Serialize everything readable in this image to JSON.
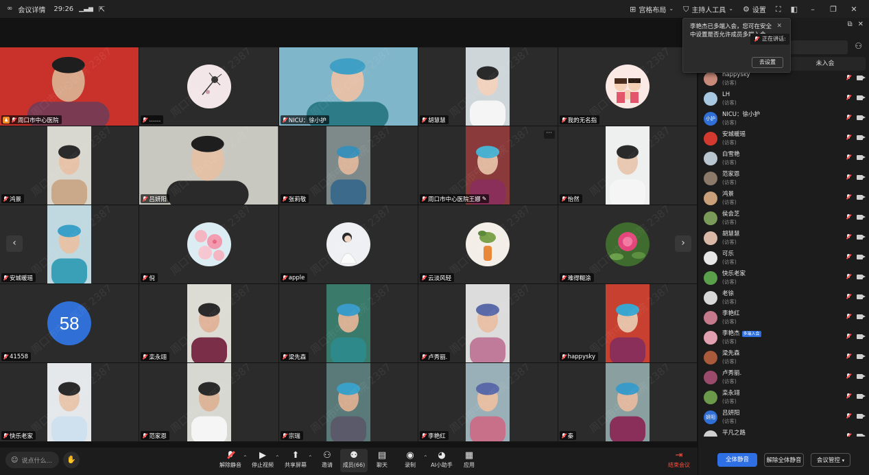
{
  "topbar": {
    "title": "会议详情",
    "duration": "29:26",
    "layout_label": "宫格布局",
    "host_tools_label": "主持人工具",
    "settings_label": "设置"
  },
  "watermark": "周口市中心医院 2387",
  "tiles": [
    {
      "name": "周口市中心医院",
      "kind": "video",
      "host": true
    },
    {
      "name": "……",
      "kind": "avatar",
      "avatar": "dandelion-flower"
    },
    {
      "name": "NICU：徐小护",
      "kind": "video"
    },
    {
      "name": "胡慧慧",
      "kind": "portrait"
    },
    {
      "name": "我的无名指",
      "kind": "avatar",
      "avatar": "cartoon-family"
    },
    {
      "name": "鸿景",
      "kind": "portrait"
    },
    {
      "name": "吕妍阳",
      "kind": "video"
    },
    {
      "name": "张莉敬",
      "kind": "portrait"
    },
    {
      "name": "周口市中心医院王娜",
      "kind": "portrait",
      "more": true,
      "pen": true
    },
    {
      "name": "怡然",
      "kind": "portrait"
    },
    {
      "name": "安城暖瑶",
      "kind": "portrait"
    },
    {
      "name": "倪",
      "kind": "avatar",
      "avatar": "pink-blossom"
    },
    {
      "name": "apple",
      "kind": "avatar",
      "avatar": "girl-white-dress"
    },
    {
      "name": "云淡风轻",
      "kind": "avatar",
      "avatar": "plant-vase"
    },
    {
      "name": "难得糊涂",
      "kind": "avatar",
      "avatar": "pink-flower"
    },
    {
      "name": "41558",
      "kind": "number",
      "number": "58"
    },
    {
      "name": "栾永翊",
      "kind": "portrait"
    },
    {
      "name": "梁先森",
      "kind": "portrait"
    },
    {
      "name": "卢秀丽.",
      "kind": "portrait"
    },
    {
      "name": "happysky",
      "kind": "portrait"
    },
    {
      "name": "快乐老家",
      "kind": "portrait"
    },
    {
      "name": "范家恩",
      "kind": "portrait"
    },
    {
      "name": "宗瑞",
      "kind": "portrait"
    },
    {
      "name": "李艳红",
      "kind": "portrait"
    },
    {
      "name": "秦",
      "kind": "portrait"
    }
  ],
  "toolbar": {
    "chat_placeholder": "说点什么...",
    "tools": [
      {
        "label": "解除静音",
        "icon": "mic-off-icon"
      },
      {
        "label": "停止视频",
        "icon": "camera-icon"
      },
      {
        "label": "共享屏幕",
        "icon": "share-screen-icon"
      },
      {
        "label": "邀请",
        "icon": "invite-icon"
      },
      {
        "label": "成员(66)",
        "icon": "members-icon"
      },
      {
        "label": "聊天",
        "icon": "chat-icon"
      },
      {
        "label": "录制",
        "icon": "record-icon"
      },
      {
        "label": "AI小助手",
        "icon": "ai-assistant-icon"
      },
      {
        "label": "应用",
        "icon": "apps-icon"
      }
    ],
    "end_label": "结束会议"
  },
  "notice": {
    "text": "李艳杰已多端入会，您可在安全中设置是否允许成员多端入会",
    "speaking": "正在讲话:",
    "button": "去设置"
  },
  "panel": {
    "tab_not_joined": "未入会",
    "role": "(访客)",
    "members": [
      {
        "name": "happysky",
        "avatar_color": "#c98a7a"
      },
      {
        "name": "LH",
        "avatar_color": "#a8c7e0"
      },
      {
        "name": "NICU：徐小护",
        "avatar_text": "小护",
        "avatar_color": "#2f6fd6"
      },
      {
        "name": "安城暖瑶",
        "avatar_color": "#d23a2f"
      },
      {
        "name": "白雪艳",
        "avatar_color": "#b9c6d0"
      },
      {
        "name": "范家恩",
        "avatar_color": "#8b7a6a"
      },
      {
        "name": "鸿景",
        "avatar_color": "#c9a07a"
      },
      {
        "name": "侯会芝",
        "avatar_color": "#7a9a5a"
      },
      {
        "name": "胡慧慧",
        "avatar_color": "#d9b8a8"
      },
      {
        "name": "可乐",
        "avatar_color": "#e6e6e6"
      },
      {
        "name": "快乐老家",
        "avatar_color": "#5aa04a"
      },
      {
        "name": "老徐",
        "avatar_color": "#d8d8d8"
      },
      {
        "name": "李艳红",
        "avatar_color": "#c47a8a"
      },
      {
        "name": "李艳杰",
        "avatar_color": "#e0a0b0",
        "badge": "多端入会"
      },
      {
        "name": "梁先森",
        "avatar_color": "#a85a3a"
      },
      {
        "name": "卢秀丽.",
        "avatar_color": "#9a4a6a"
      },
      {
        "name": "栾永翊",
        "avatar_color": "#6a9a4a"
      },
      {
        "name": "吕妍阳",
        "avatar_text": "妍阳",
        "avatar_color": "#2f6fd6"
      },
      {
        "name": "平凡之路",
        "avatar_color": "#cfcfcf"
      }
    ],
    "mute_all": "全体静音",
    "unmute_all": "解除全体静音",
    "meeting_control": "会议管控"
  }
}
